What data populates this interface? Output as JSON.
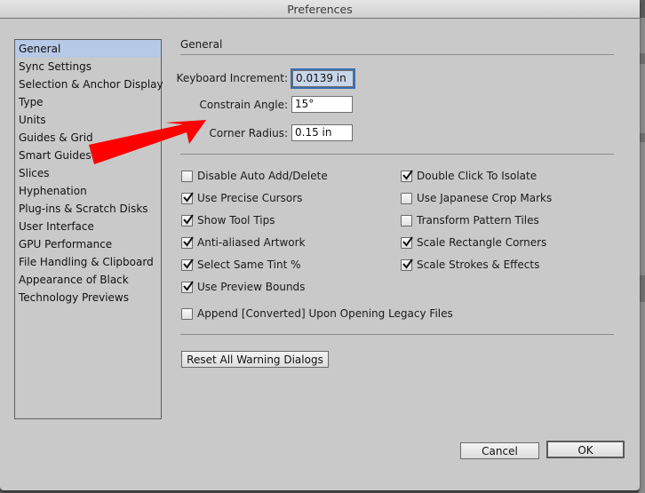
{
  "window": {
    "title": "Preferences"
  },
  "sidebar": {
    "items": [
      {
        "label": "General",
        "selected": true
      },
      {
        "label": "Sync Settings"
      },
      {
        "label": "Selection & Anchor Display"
      },
      {
        "label": "Type"
      },
      {
        "label": "Units"
      },
      {
        "label": "Guides & Grid"
      },
      {
        "label": "Smart Guides"
      },
      {
        "label": "Slices"
      },
      {
        "label": "Hyphenation"
      },
      {
        "label": "Plug-ins & Scratch Disks"
      },
      {
        "label": "User Interface"
      },
      {
        "label": "GPU Performance"
      },
      {
        "label": "File Handling & Clipboard"
      },
      {
        "label": "Appearance of Black"
      },
      {
        "label": "Technology Previews"
      }
    ]
  },
  "main": {
    "section_title": "General",
    "fields": {
      "keyboard_increment": {
        "label": "Keyboard Increment:",
        "value": "0.0139 in"
      },
      "constrain_angle": {
        "label": "Constrain Angle:",
        "value": "15°"
      },
      "corner_radius": {
        "label": "Corner Radius:",
        "value": "0.15 in"
      }
    },
    "checkboxes_left": [
      {
        "label": "Disable Auto Add/Delete",
        "checked": false
      },
      {
        "label": "Use Precise Cursors",
        "checked": true
      },
      {
        "label": "Show Tool Tips",
        "checked": true
      },
      {
        "label": "Anti-aliased Artwork",
        "checked": true
      },
      {
        "label": "Select Same Tint %",
        "checked": true
      },
      {
        "label": "Use Preview Bounds",
        "checked": true
      }
    ],
    "checkboxes_right": [
      {
        "label": "Double Click To Isolate",
        "checked": true
      },
      {
        "label": "Use Japanese Crop Marks",
        "checked": false
      },
      {
        "label": "Transform Pattern Tiles",
        "checked": false
      },
      {
        "label": "Scale Rectangle Corners",
        "checked": true
      },
      {
        "label": "Scale Strokes & Effects",
        "checked": true
      }
    ],
    "append_converted": {
      "label": "Append [Converted] Upon Opening Legacy Files",
      "checked": false
    },
    "reset_warnings_label": "Reset All Warning Dialogs"
  },
  "footer": {
    "cancel_label": "Cancel",
    "ok_label": "OK"
  },
  "annotation": {
    "type": "arrow",
    "color": "#ff0000",
    "points_to": "Constrain Angle field"
  }
}
